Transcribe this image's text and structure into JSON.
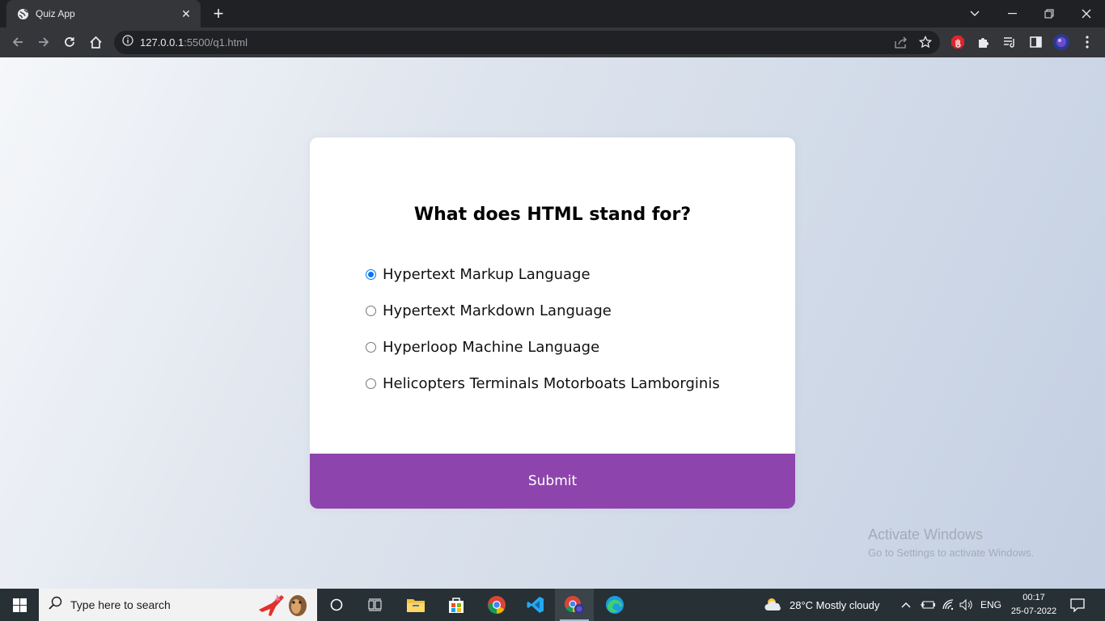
{
  "browser": {
    "tab_title": "Quiz App",
    "url_host": "127.0.0.1",
    "url_rest": ":5500/q1.html"
  },
  "quiz": {
    "question": "What does HTML stand for?",
    "answers": [
      "Hypertext Markup Language",
      "Hypertext Markdown Language",
      "Hyperloop Machine Language",
      "Helicopters Terminals Motorboats Lamborginis"
    ],
    "selected_index": 0,
    "submit_label": "Submit"
  },
  "watermark": {
    "title": "Activate Windows",
    "subtitle": "Go to Settings to activate Windows."
  },
  "taskbar": {
    "search_placeholder": "Type here to search",
    "weather": "28°C  Mostly cloudy",
    "language": "ENG",
    "time": "00:17",
    "date": "25-07-2022"
  },
  "colors": {
    "submit_bg": "#8e44ad",
    "radio_accent": "#0075ff"
  }
}
